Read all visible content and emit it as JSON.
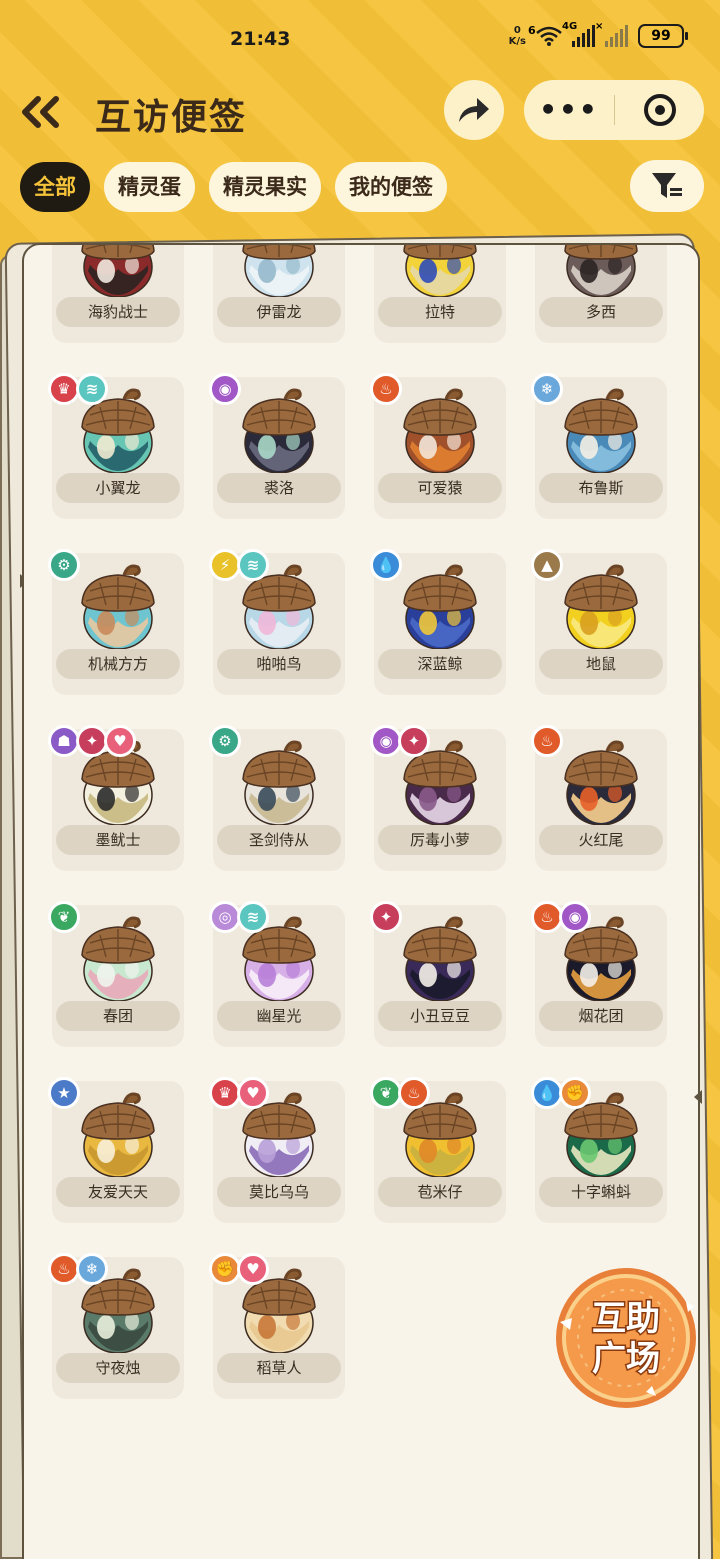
{
  "status_bar": {
    "time": "21:43",
    "net_speed_value": "0",
    "net_speed_unit": "K/s",
    "wifi_tag": "6",
    "signal_tag": "4G",
    "signal2_tag": "×",
    "battery": "99"
  },
  "header": {
    "back_icon": "double-chevron-left-icon",
    "title": "互访便签",
    "share_icon": "share-arrow-icon",
    "more_label": "•••",
    "close_icon": "target-circle-icon"
  },
  "tabs": [
    {
      "label": "全部",
      "active": true
    },
    {
      "label": "精灵蛋",
      "active": false
    },
    {
      "label": "精灵果实",
      "active": false
    },
    {
      "label": "我的便签",
      "active": false
    }
  ],
  "filter_icon": "filter-icon",
  "cards": [
    {
      "name": "海豹战士",
      "badges": [
        {
          "type": "fire",
          "color": "#7aa9d8",
          "glyph": "❄"
        },
        {
          "type": "rock",
          "color": "#e86a4a",
          "glyph": "✦"
        }
      ],
      "colors": [
        "#8b2a2a",
        "#f0e8de",
        "#2b2420"
      ]
    },
    {
      "name": "伊雷龙",
      "badges": [
        {
          "type": "evil",
          "color": "#c73d5c",
          "glyph": "✦"
        }
      ],
      "colors": [
        "#cfe3ee",
        "#96b9cc",
        "#eef4f6"
      ]
    },
    {
      "name": "拉特",
      "badges": [
        {
          "type": "elec",
          "color": "#e9c22a",
          "glyph": "⚡"
        }
      ],
      "colors": [
        "#f2d33a",
        "#2f4db8",
        "#e6d8a8"
      ]
    },
    {
      "name": "多西",
      "badges": [
        {
          "type": "water",
          "color": "#6bc7b8",
          "glyph": "✦"
        },
        {
          "type": "dark",
          "color": "#7a6b5a",
          "glyph": "✦"
        }
      ],
      "colors": [
        "#6b5c5a",
        "#2c2424",
        "#d9d0c6"
      ]
    },
    {
      "name": "小翼龙",
      "badges": [
        {
          "type": "dragon",
          "color": "#d8424a",
          "glyph": "♛"
        },
        {
          "type": "wing",
          "color": "#5bc6c0",
          "glyph": "≋"
        }
      ],
      "colors": [
        "#67c5b4",
        "#f0ead0",
        "#245e68"
      ]
    },
    {
      "name": "裘洛",
      "badges": [
        {
          "type": "poison",
          "color": "#a158c6",
          "glyph": "◉"
        }
      ],
      "colors": [
        "#2a2a3a",
        "#a8d8c8",
        "#6a6a80"
      ]
    },
    {
      "name": "可爱猿",
      "badges": [
        {
          "type": "fire",
          "color": "#e05a2a",
          "glyph": "♨"
        }
      ],
      "colors": [
        "#a0502a",
        "#f3e6d8",
        "#e08030"
      ]
    },
    {
      "name": "布鲁斯",
      "badges": [
        {
          "type": "ice",
          "color": "#6aa8dc",
          "glyph": "❄"
        }
      ],
      "colors": [
        "#4a8ab8",
        "#f4efe4",
        "#8ac0e0"
      ]
    },
    {
      "name": "机械方方",
      "badges": [
        {
          "type": "mech",
          "color": "#3aa888",
          "glyph": "⚙"
        }
      ],
      "colors": [
        "#6ec5cf",
        "#c98a5a",
        "#e8c8a0"
      ]
    },
    {
      "name": "啪啪鸟",
      "badges": [
        {
          "type": "elec",
          "color": "#e9c22a",
          "glyph": "⚡"
        },
        {
          "type": "wing",
          "color": "#5bc6c0",
          "glyph": "≋"
        }
      ],
      "colors": [
        "#b8d8e8",
        "#f0b8d8",
        "#e8eef4"
      ]
    },
    {
      "name": "深蓝鲸",
      "badges": [
        {
          "type": "water",
          "color": "#3a8cd8",
          "glyph": "💧"
        }
      ],
      "colors": [
        "#2a3f9a",
        "#f0c83a",
        "#4a6ac8"
      ]
    },
    {
      "name": "地鼠",
      "badges": [
        {
          "type": "ground",
          "color": "#9a7a4a",
          "glyph": "▲"
        }
      ],
      "colors": [
        "#f2d020",
        "#d8a020",
        "#f8e880"
      ]
    },
    {
      "name": "墨鱿士",
      "badges": [
        {
          "type": "ghost",
          "color": "#8a5ac6",
          "glyph": "☗"
        },
        {
          "type": "evil",
          "color": "#c73d5c",
          "glyph": "✦"
        },
        {
          "type": "cute",
          "color": "#e8607a",
          "glyph": "♥"
        }
      ],
      "colors": [
        "#f4f0e0",
        "#2a2a2a",
        "#c8b880"
      ]
    },
    {
      "name": "圣剑侍从",
      "badges": [
        {
          "type": "mech",
          "color": "#3aa888",
          "glyph": "⚙"
        }
      ],
      "colors": [
        "#e8e4dc",
        "#3a4a5a",
        "#c8b890"
      ]
    },
    {
      "name": "厉毒小萝",
      "badges": [
        {
          "type": "poison",
          "color": "#a158c6",
          "glyph": "◉"
        },
        {
          "type": "evil",
          "color": "#c73d5c",
          "glyph": "✦"
        }
      ],
      "colors": [
        "#4a2a4a",
        "#8a5a8a",
        "#e8d8e8"
      ]
    },
    {
      "name": "火红尾",
      "badges": [
        {
          "type": "fire",
          "color": "#e05a2a",
          "glyph": "♨"
        }
      ],
      "colors": [
        "#2a2a3a",
        "#e8602a",
        "#f8d090"
      ]
    },
    {
      "name": "春团",
      "badges": [
        {
          "type": "grass",
          "color": "#3aa860",
          "glyph": "❦"
        }
      ],
      "colors": [
        "#c8e8d0",
        "#f0f4ec",
        "#e8a8b8"
      ]
    },
    {
      "name": "幽星光",
      "badges": [
        {
          "type": "spirit",
          "color": "#b88ad8",
          "glyph": "◎"
        },
        {
          "type": "wing",
          "color": "#5bc6c0",
          "glyph": "≋"
        }
      ],
      "colors": [
        "#d8b0e8",
        "#b880d8",
        "#f8f0f8"
      ]
    },
    {
      "name": "小丑豆豆",
      "badges": [
        {
          "type": "evil",
          "color": "#c73d5c",
          "glyph": "✦"
        }
      ],
      "colors": [
        "#3a2a5a",
        "#f4f0e8",
        "#1a1a2a"
      ]
    },
    {
      "name": "烟花团",
      "badges": [
        {
          "type": "fire",
          "color": "#e05a2a",
          "glyph": "♨"
        },
        {
          "type": "poison",
          "color": "#a158c6",
          "glyph": "◉"
        }
      ],
      "colors": [
        "#1a1a2a",
        "#f4f0e8",
        "#e8a040"
      ]
    },
    {
      "name": "友爱天天",
      "badges": [
        {
          "type": "normal",
          "color": "#4a7ac8",
          "glyph": "★"
        }
      ],
      "colors": [
        "#e8b840",
        "#f8f0d8",
        "#c89830"
      ]
    },
    {
      "name": "莫比乌乌",
      "badges": [
        {
          "type": "dragon",
          "color": "#d8424a",
          "glyph": "♛"
        },
        {
          "type": "cute",
          "color": "#e8607a",
          "glyph": "♥"
        }
      ],
      "colors": [
        "#f0eef4",
        "#b8a0d8",
        "#8a6ab8"
      ]
    },
    {
      "name": "苞米仔",
      "badges": [
        {
          "type": "grass",
          "color": "#3aa860",
          "glyph": "❦"
        },
        {
          "type": "fire",
          "color": "#e05a2a",
          "glyph": "♨"
        }
      ],
      "colors": [
        "#f0c030",
        "#e08828",
        "#c8b040"
      ]
    },
    {
      "name": "十字蝌蚪",
      "badges": [
        {
          "type": "water",
          "color": "#3a8cd8",
          "glyph": "💧"
        },
        {
          "type": "fight",
          "color": "#e88a3a",
          "glyph": "✊"
        }
      ],
      "colors": [
        "#1a6a4a",
        "#6ac870",
        "#e8e8c0"
      ]
    },
    {
      "name": "守夜烛",
      "badges": [
        {
          "type": "fire",
          "color": "#e05a2a",
          "glyph": "♨"
        },
        {
          "type": "ice",
          "color": "#6aa8dc",
          "glyph": "❄"
        }
      ],
      "colors": [
        "#5a7a6a",
        "#e8eedc",
        "#3a4a40"
      ]
    },
    {
      "name": "稻草人",
      "badges": [
        {
          "type": "fight",
          "color": "#e88a3a",
          "glyph": "✊"
        },
        {
          "type": "cute",
          "color": "#e8607a",
          "glyph": "♥"
        }
      ],
      "colors": [
        "#f0dcb0",
        "#c8783a",
        "#e8c890"
      ]
    }
  ],
  "mutual_help": {
    "line1": "互助",
    "line2": "广场",
    "icon": "mutual-help-plaza-badge-icon"
  }
}
